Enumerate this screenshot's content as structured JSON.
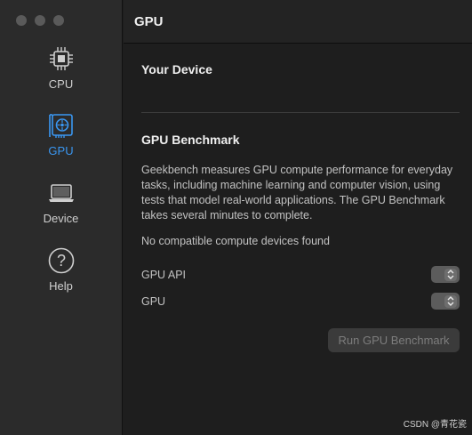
{
  "sidebar": {
    "items": [
      {
        "label": "CPU",
        "icon": "cpu-icon",
        "active": false
      },
      {
        "label": "GPU",
        "icon": "gpu-icon",
        "active": true
      },
      {
        "label": "Device",
        "icon": "laptop-icon",
        "active": false
      },
      {
        "label": "Help",
        "icon": "question-icon",
        "active": false
      }
    ]
  },
  "header": {
    "title": "GPU"
  },
  "main": {
    "your_device_title": "Your Device",
    "benchmark_title": "GPU Benchmark",
    "description": "Geekbench measures GPU compute performance for everyday tasks, including machine learning and computer vision, using tests that model real-world applications. The GPU Benchmark takes several minutes to complete.",
    "status": "No compatible compute devices found",
    "gpu_api_label": "GPU API",
    "gpu_label": "GPU",
    "run_button": "Run GPU Benchmark"
  },
  "watermark": "CSDN @青花瓷",
  "colors": {
    "accent": "#3a97f2",
    "sidebar_bg": "#2b2b2b",
    "main_bg": "#1e1e1e"
  }
}
